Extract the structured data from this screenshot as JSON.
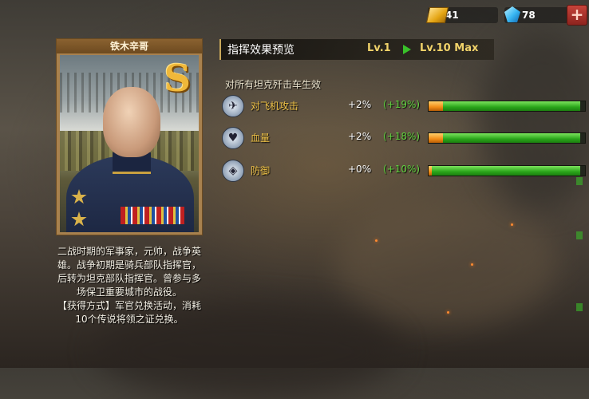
{
  "resources": {
    "gold": {
      "icon": "gold-bar-icon",
      "value": "41"
    },
    "gems": {
      "icon": "diamond-icon",
      "value": "78"
    },
    "add_button_icon": "plus-icon"
  },
  "commander": {
    "name": "铁木辛哥",
    "rank": "S",
    "description": [
      "二战时期的军事家，元帅，战争英雄。战争初期是骑兵部队指挥官，后转为坦克部队指挥官。曾参与多场保卫重要城市的战役。",
      "【获得方式】军官兑换活动，消耗10个传说将领之证兑换。"
    ]
  },
  "effects_panel": {
    "title": "指挥效果预览",
    "level_from": "Lv.1",
    "level_to": "Lv.10 Max",
    "subtitle": "对所有坦克歼击车生效",
    "rows": [
      {
        "icon": "aircraft-icon",
        "name": "对飞机攻击",
        "base": "+2%",
        "max": "(+19%)",
        "current_fraction": 0.02,
        "max_fraction": 0.19
      },
      {
        "icon": "heart-icon",
        "name": "血量",
        "base": "+2%",
        "max": "(+18%)",
        "current_fraction": 0.02,
        "max_fraction": 0.18
      },
      {
        "icon": "shield-icon",
        "name": "防御",
        "base": "+0%",
        "max": "(+10%)",
        "current_fraction": 0.0,
        "max_fraction": 0.1
      }
    ]
  },
  "colors": {
    "level_text": "#f1d36a",
    "stat_name": "#f0c348",
    "max_value": "#5fd13e",
    "bar_green": "#2aa51a",
    "bar_orange": "#f28d17"
  }
}
